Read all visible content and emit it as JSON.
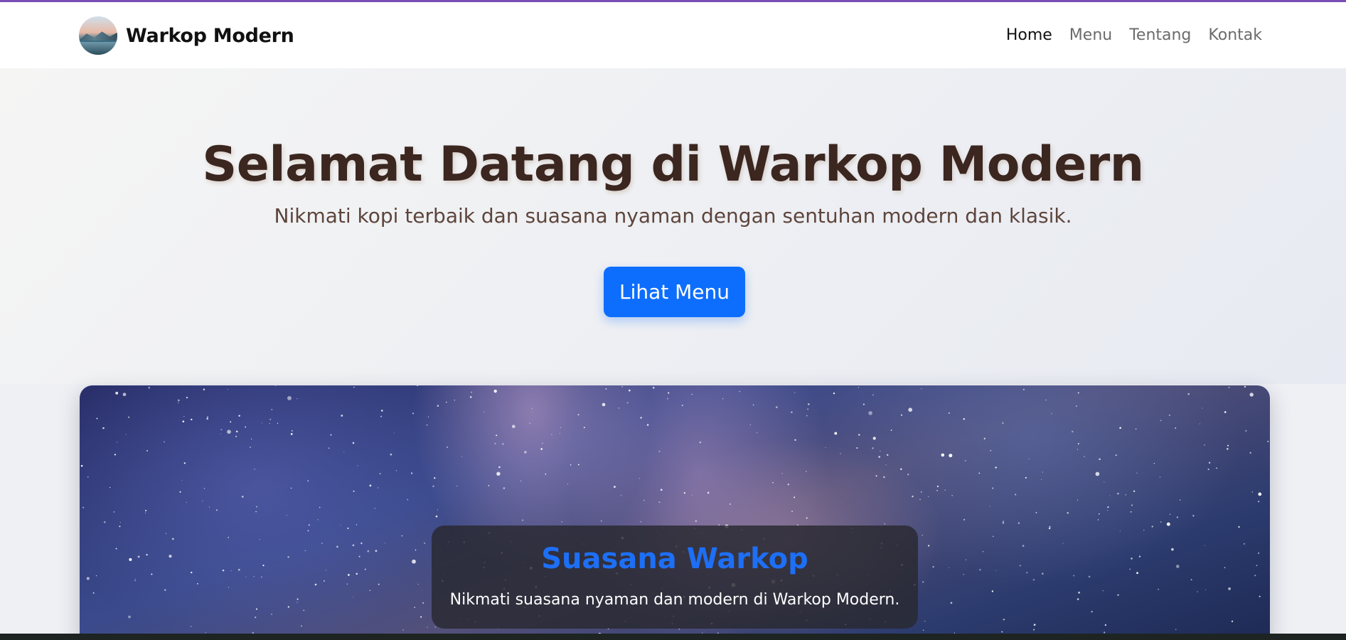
{
  "navbar": {
    "brand": "Warkop Modern",
    "links": [
      {
        "label": "Home",
        "active": true
      },
      {
        "label": "Menu",
        "active": false
      },
      {
        "label": "Tentang",
        "active": false
      },
      {
        "label": "Kontak",
        "active": false
      }
    ]
  },
  "hero": {
    "title": "Selamat Datang di Warkop Modern",
    "subtitle": "Nikmati kopi terbaik dan suasana nyaman dengan sentuhan modern dan klasik.",
    "cta_label": "Lihat Menu"
  },
  "gallery": {
    "caption_title": "Suasana Warkop",
    "caption_text": "Nikmati suasana nyaman dan modern di Warkop Modern."
  },
  "colors": {
    "accent": "#0d6efd",
    "title": "#3b2620",
    "caption_title": "#1d6ff5",
    "topline": "#7b4fb8"
  }
}
